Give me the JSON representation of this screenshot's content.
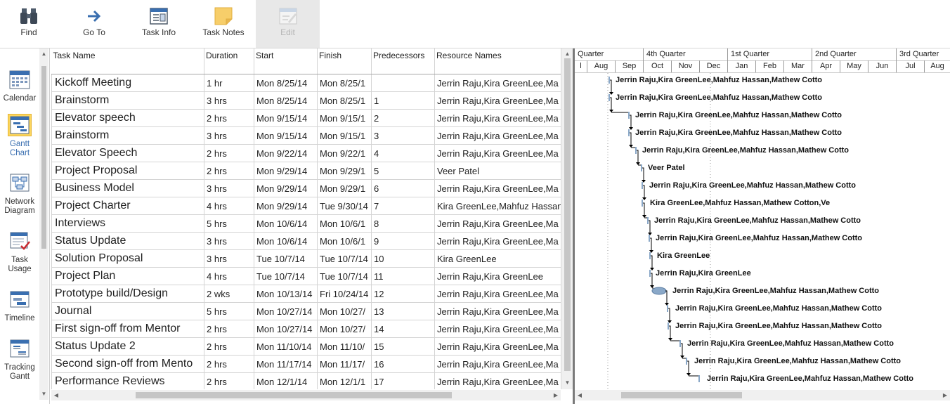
{
  "ribbon": {
    "find": "Find",
    "goto": "Go To",
    "task_info": "Task Info",
    "task_notes": "Task Notes",
    "edit": "Edit"
  },
  "views": [
    {
      "label": "Calendar",
      "icon": "calendar-icon"
    },
    {
      "label": "Gantt Chart",
      "icon": "gantt-chart-icon",
      "active": true
    },
    {
      "label": "Network Diagram",
      "icon": "network-diagram-icon"
    },
    {
      "label": "Task Usage",
      "icon": "task-usage-icon"
    },
    {
      "label": "Timeline",
      "icon": "timeline-icon"
    },
    {
      "label": "Tracking Gantt",
      "icon": "tracking-gantt-icon"
    }
  ],
  "table": {
    "headers": {
      "task_name": "Task Name",
      "duration": "Duration",
      "start": "Start",
      "finish": "Finish",
      "predecessors": "Predecessors",
      "resource_names": "Resource Names"
    },
    "rows": [
      {
        "name": "Kickoff Meeting",
        "duration": "1 hr",
        "start": "Mon 8/25/14",
        "finish": "Mon 8/25/1",
        "pred": "",
        "res": "Jerrin Raju,Kira GreenLee,Ma"
      },
      {
        "name": "Brainstorm",
        "duration": "3 hrs",
        "start": "Mon 8/25/14",
        "finish": "Mon 8/25/1",
        "pred": "1",
        "res": "Jerrin Raju,Kira GreenLee,Ma"
      },
      {
        "name": "Elevator speech",
        "duration": "2 hrs",
        "start": "Mon 9/15/14",
        "finish": "Mon 9/15/1",
        "pred": "2",
        "res": "Jerrin Raju,Kira GreenLee,Ma"
      },
      {
        "name": "Brainstorm",
        "duration": "3 hrs",
        "start": "Mon 9/15/14",
        "finish": "Mon 9/15/1",
        "pred": "3",
        "res": "Jerrin Raju,Kira GreenLee,Ma"
      },
      {
        "name": "Elevator Speech",
        "duration": "2 hrs",
        "start": "Mon 9/22/14",
        "finish": "Mon 9/22/1",
        "pred": "4",
        "res": "Jerrin Raju,Kira GreenLee,Ma"
      },
      {
        "name": "Project Proposal",
        "duration": "2 hrs",
        "start": "Mon 9/29/14",
        "finish": "Mon 9/29/1",
        "pred": "5",
        "res": "Veer Patel"
      },
      {
        "name": "Business Model",
        "duration": "3 hrs",
        "start": "Mon 9/29/14",
        "finish": "Mon 9/29/1",
        "pred": "6",
        "res": "Jerrin Raju,Kira GreenLee,Ma"
      },
      {
        "name": "Project Charter",
        "duration": "4 hrs",
        "start": "Mon 9/29/14",
        "finish": "Tue 9/30/14",
        "pred": "7",
        "res": "Kira GreenLee,Mahfuz Hassan"
      },
      {
        "name": "Interviews",
        "duration": "5 hrs",
        "start": "Mon 10/6/14",
        "finish": "Mon 10/6/1",
        "pred": "8",
        "res": "Jerrin Raju,Kira GreenLee,Ma"
      },
      {
        "name": "Status Update",
        "duration": "3 hrs",
        "start": "Mon 10/6/14",
        "finish": "Mon 10/6/1",
        "pred": "9",
        "res": "Jerrin Raju,Kira GreenLee,Ma"
      },
      {
        "name": "Solution Proposal",
        "duration": "3 hrs",
        "start": "Tue 10/7/14",
        "finish": "Tue 10/7/14",
        "pred": "10",
        "res": "Kira GreenLee"
      },
      {
        "name": "Project Plan",
        "duration": "4 hrs",
        "start": "Tue 10/7/14",
        "finish": "Tue 10/7/14",
        "pred": "11",
        "res": "Jerrin Raju,Kira GreenLee"
      },
      {
        "name": "Prototype build/Design",
        "duration": "2 wks",
        "start": "Mon 10/13/14",
        "finish": "Fri 10/24/14",
        "pred": "12",
        "res": "Jerrin Raju,Kira GreenLee,Ma"
      },
      {
        "name": "Journal",
        "duration": "5 hrs",
        "start": "Mon 10/27/14",
        "finish": "Mon 10/27/",
        "pred": "13",
        "res": "Jerrin Raju,Kira GreenLee,Ma"
      },
      {
        "name": "First sign-off from Mentor",
        "duration": "2 hrs",
        "start": "Mon 10/27/14",
        "finish": "Mon 10/27/",
        "pred": "14",
        "res": "Jerrin Raju,Kira GreenLee,Ma"
      },
      {
        "name": "Status Update 2",
        "duration": "2 hrs",
        "start": "Mon 11/10/14",
        "finish": "Mon 11/10/",
        "pred": "15",
        "res": "Jerrin Raju,Kira GreenLee,Ma"
      },
      {
        "name": "Second sign-off from Mento",
        "duration": "2 hrs",
        "start": "Mon 11/17/14",
        "finish": "Mon 11/17/",
        "pred": "16",
        "res": "Jerrin Raju,Kira GreenLee,Ma"
      },
      {
        "name": "Performance Reviews",
        "duration": "2 hrs",
        "start": "Mon 12/1/14",
        "finish": "Mon 12/1/1",
        "pred": "17",
        "res": "Jerrin Raju,Kira GreenLee,Ma"
      }
    ]
  },
  "gantt": {
    "quarters": [
      "Quarter",
      "4th Quarter",
      "1st Quarter",
      "2nd Quarter",
      "3rd Quarter"
    ],
    "months": [
      "l",
      "Aug",
      "Sep",
      "Oct",
      "Nov",
      "Dec",
      "Jan",
      "Feb",
      "Mar",
      "Apr",
      "May",
      "Jun",
      "Jul",
      "Aug"
    ],
    "bar_labels": [
      "Jerrin Raju,Kira GreenLee,Mahfuz Hassan,Mathew Cotto",
      "Jerrin Raju,Kira GreenLee,Mahfuz Hassan,Mathew Cotto",
      "Jerrin Raju,Kira GreenLee,Mahfuz Hassan,Mathew Cotto",
      "Jerrin Raju,Kira GreenLee,Mahfuz Hassan,Mathew Cotto",
      "Jerrin Raju,Kira GreenLee,Mahfuz Hassan,Mathew Cotto",
      "Veer Patel",
      "Jerrin Raju,Kira GreenLee,Mahfuz Hassan,Mathew Cotto",
      "Kira GreenLee,Mahfuz Hassan,Mathew Cotton,Ve",
      "Jerrin Raju,Kira GreenLee,Mahfuz Hassan,Mathew Cotto",
      "Jerrin Raju,Kira GreenLee,Mahfuz Hassan,Mathew Cotto",
      "Kira GreenLee",
      "Jerrin Raju,Kira GreenLee",
      "Jerrin Raju,Kira GreenLee,Mahfuz Hassan,Mathew Cotto",
      "Jerrin Raju,Kira GreenLee,Mahfuz Hassan,Mathew Cotto",
      "Jerrin Raju,Kira GreenLee,Mahfuz Hassan,Mathew Cotto",
      "Jerrin Raju,Kira GreenLee,Mahfuz Hassan,Mathew Cotto",
      "Jerrin Raju,Kira GreenLee,Mahfuz Hassan,Mathew Cotto",
      "Jerrin Raju,Kira GreenLee,Mahfuz Hassan,Mathew Cotto"
    ]
  },
  "colors": {
    "accent": "#fcd65e",
    "bar": "#8aa8c8",
    "dependency": "#000000"
  }
}
